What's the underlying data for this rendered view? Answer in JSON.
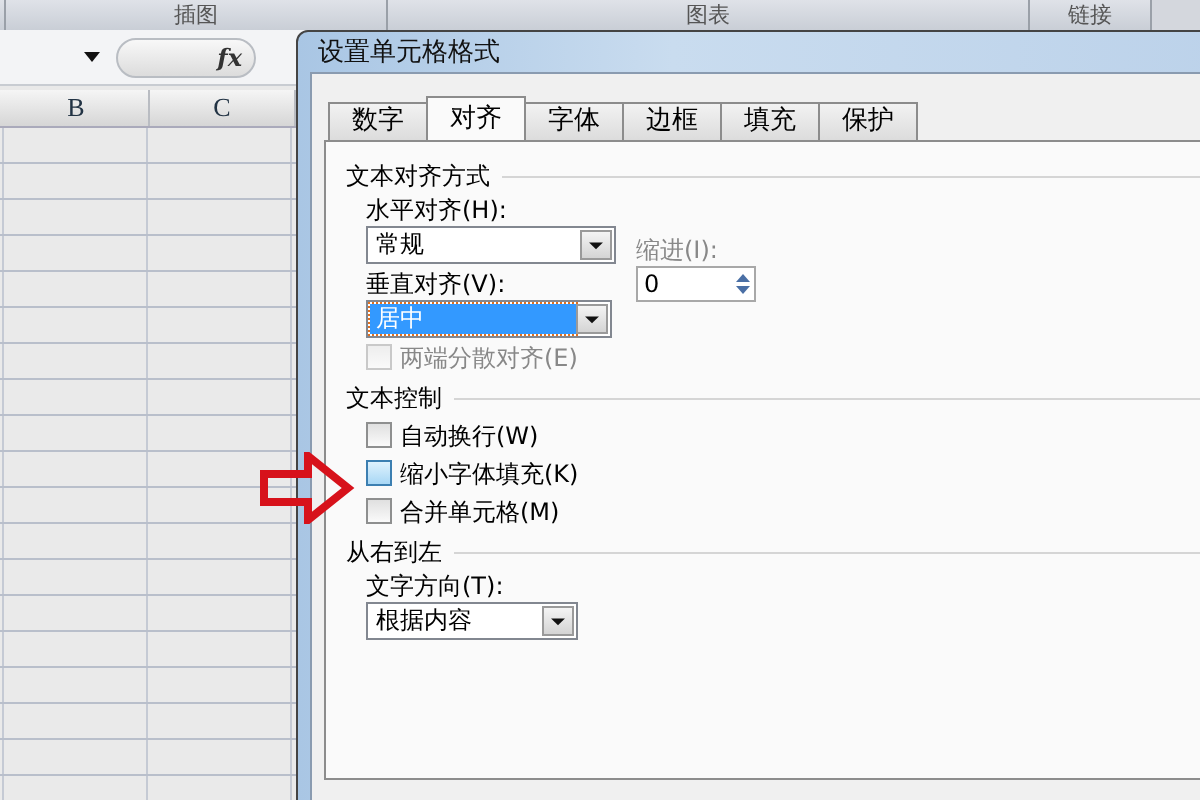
{
  "ribbon_groups": [
    {
      "label": "插图"
    },
    {
      "label": "图表"
    },
    {
      "label": "链接"
    }
  ],
  "formula_bar": {
    "fx": "fx"
  },
  "columns": [
    {
      "label": "B"
    },
    {
      "label": "C"
    }
  ],
  "dialog": {
    "title": "设置单元格格式",
    "tabs": [
      {
        "label": "数字",
        "selected": false
      },
      {
        "label": "对齐",
        "selected": true
      },
      {
        "label": "字体",
        "selected": false
      },
      {
        "label": "边框",
        "selected": false
      },
      {
        "label": "填充",
        "selected": false
      },
      {
        "label": "保护",
        "selected": false
      }
    ],
    "alignment": {
      "heading": "文本对齐方式",
      "horizontal": {
        "label": "水平对齐(H):",
        "value": "常规",
        "focused": false
      },
      "indent": {
        "label": "缩进(I):",
        "value": "0"
      },
      "vertical": {
        "label": "垂直对齐(V):",
        "value": "居中",
        "focused": true
      },
      "distributed": {
        "label": "两端分散对齐(E)",
        "checked": false,
        "disabled": true,
        "highlighted": false
      }
    },
    "text_control": {
      "heading": "文本控制",
      "options": [
        {
          "label": "自动换行(W)",
          "checked": false,
          "disabled": false,
          "highlighted": false
        },
        {
          "label": "缩小字体填充(K)",
          "checked": false,
          "disabled": false,
          "highlighted": true
        },
        {
          "label": "合并单元格(M)",
          "checked": false,
          "disabled": false,
          "highlighted": false
        }
      ]
    },
    "rtl": {
      "heading": "从右到左",
      "direction": {
        "label": "文字方向(T):",
        "value": "根据内容",
        "focused": false
      }
    }
  }
}
